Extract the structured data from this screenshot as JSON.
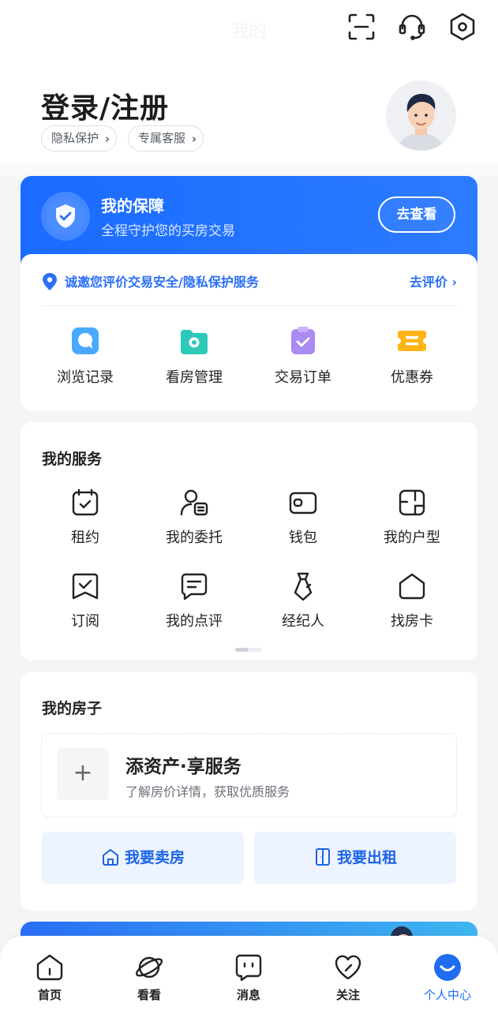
{
  "top": {
    "title": "我的",
    "icons": [
      "scan-icon",
      "customer-service-icon",
      "settings-icon"
    ]
  },
  "header": {
    "login_title": "登录/注册",
    "chips": [
      "隐私保护",
      "专属客服"
    ]
  },
  "guard": {
    "title": "我的保障",
    "subtitle": "全程守护您的买房交易",
    "button": "去查看",
    "eval_text": "诚邀您评价交易安全/隐私保护服务",
    "eval_link": "去评价",
    "quick": [
      {
        "label": "浏览记录",
        "icon": "browse-history-icon"
      },
      {
        "label": "看房管理",
        "icon": "viewing-management-icon"
      },
      {
        "label": "交易订单",
        "icon": "transaction-order-icon"
      },
      {
        "label": "优惠券",
        "icon": "coupon-icon"
      }
    ]
  },
  "services": {
    "title": "我的服务",
    "items": [
      {
        "label": "租约",
        "icon": "calendar-check-icon"
      },
      {
        "label": "我的委托",
        "icon": "entrust-icon"
      },
      {
        "label": "钱包",
        "icon": "wallet-icon"
      },
      {
        "label": "我的户型",
        "icon": "floor-plan-icon"
      },
      {
        "label": "订阅",
        "icon": "subscribe-icon"
      },
      {
        "label": "我的点评",
        "icon": "comment-icon"
      },
      {
        "label": "经纪人",
        "icon": "agent-tie-icon"
      },
      {
        "label": "找房卡",
        "icon": "house-card-icon"
      }
    ]
  },
  "house": {
    "title": "我的房子",
    "asset_title": "添资产·享服务",
    "asset_sub": "了解房价详情，获取优质服务",
    "plus": "+",
    "sell": "我要卖房",
    "rent": "我要出租"
  },
  "tabs": [
    {
      "label": "首页",
      "icon": "home-icon"
    },
    {
      "label": "看看",
      "icon": "planet-icon"
    },
    {
      "label": "消息",
      "icon": "message-icon"
    },
    {
      "label": "关注",
      "icon": "heart-icon"
    },
    {
      "label": "个人中心",
      "icon": "profile-icon",
      "active": true
    }
  ],
  "colors": {
    "accent": "#1f6cf0",
    "guard_blue": "#1a6bff",
    "button_bg": "#eef4ff"
  }
}
